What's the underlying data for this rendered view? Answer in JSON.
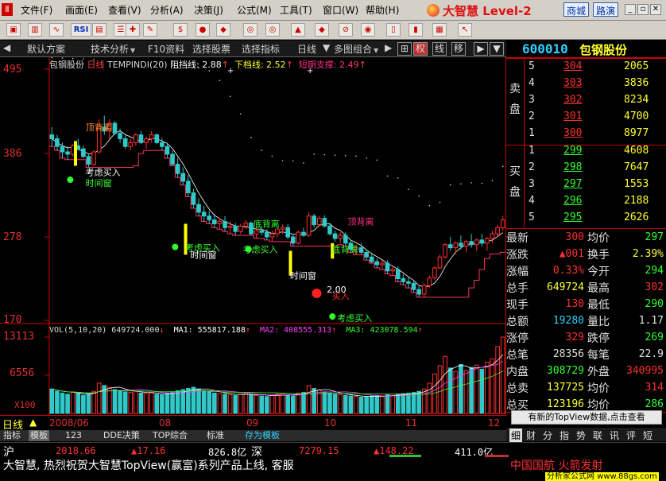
{
  "menu": {
    "items": [
      "文件(F)",
      "画面(E)",
      "查看(V)",
      "分析(A)",
      "决策(J)",
      "公式(M)",
      "工具(T)",
      "窗口(W)",
      "帮助(H)"
    ],
    "brand": "大智慧 Level-2",
    "mall": "商城",
    "roadshow": "路演"
  },
  "toolbar": {
    "icons": [
      "open-icon",
      "kline-icon",
      "minute-icon",
      "rsi-icon",
      "stats-icon",
      "list-icon",
      "crosshair-icon",
      "draw-icon",
      "dollar-icon",
      "traffic-icon",
      "diamond-icon",
      "binoculars-icon",
      "binoculars2-icon",
      "flag-icon",
      "warning-icon",
      "ban-icon",
      "globe-icon",
      "notepad-icon",
      "books-icon",
      "grid-icon",
      "help-arrow-icon"
    ]
  },
  "tabs": {
    "items": [
      "默认方案",
      "技术分析",
      "F10资料",
      "选择股票",
      "选择指标",
      "日线",
      "多图组合"
    ],
    "right": [
      "权",
      "线",
      "移",
      "▶"
    ]
  },
  "chart": {
    "title": "包钢股份",
    "period": "日线",
    "indicator": "TEMPINDI(20)",
    "resistance_label": "阻挡线: 2.88",
    "support_label": "下档线: 2.52",
    "short_support_label": "短期支撑: 2.49",
    "y_ticks": [
      "495",
      "386",
      "278",
      "170"
    ],
    "vol_header": "VOL(5,10,20) 649724.000",
    "ma1": "MA1: 555817.188",
    "ma2": "MA2: 408555.313",
    "ma3": "MA3: 423078.594",
    "vol_ticks": [
      "13113",
      "6556",
      "X100"
    ],
    "date_ticks": [
      "2008/06",
      "08",
      "09",
      "10",
      "11",
      "12"
    ],
    "period_badge": "日线",
    "annotations": [
      "顶背离",
      "考虑买入",
      "时间窗",
      "考虑买入",
      "时间窗",
      "底背离",
      "考虑买入",
      "时间窗",
      "买入",
      "2.00",
      "顶背离",
      "底背离",
      "考虑买入"
    ],
    "colors": {
      "up": "#ff3030",
      "down": "#30c8c8",
      "ma": "#ffffff",
      "signal": "#ffff00",
      "support": "#ff3060"
    },
    "vol_ymax": 13113,
    "chart_data": {
      "type": "candlestick",
      "price_axis": [
        1.7,
        4.95
      ],
      "ohlc": [
        [
          4.1,
          4.2,
          3.95,
          4.05
        ],
        [
          4.05,
          4.1,
          3.9,
          3.95
        ],
        [
          3.95,
          4.0,
          3.8,
          3.88
        ],
        [
          3.88,
          3.95,
          3.78,
          3.85
        ],
        [
          3.85,
          3.98,
          3.82,
          3.96
        ],
        [
          3.96,
          4.05,
          3.9,
          3.92
        ],
        [
          3.92,
          3.96,
          3.8,
          3.82
        ],
        [
          3.82,
          3.86,
          3.68,
          3.72
        ],
        [
          3.72,
          3.9,
          3.7,
          3.88
        ],
        [
          3.88,
          4.3,
          3.86,
          4.2
        ],
        [
          4.2,
          4.35,
          4.1,
          4.15
        ],
        [
          4.15,
          4.3,
          4.05,
          4.25
        ],
        [
          4.25,
          4.28,
          4.1,
          4.12
        ],
        [
          4.12,
          4.18,
          4.0,
          4.05
        ],
        [
          4.05,
          4.1,
          3.92,
          3.95
        ],
        [
          3.95,
          4.05,
          3.9,
          4.0
        ],
        [
          4.0,
          4.12,
          3.96,
          4.1
        ],
        [
          4.1,
          4.15,
          3.98,
          4.0
        ],
        [
          4.0,
          4.08,
          3.92,
          4.05
        ],
        [
          4.05,
          4.15,
          4.0,
          4.1
        ],
        [
          4.1,
          4.12,
          3.98,
          4.0
        ],
        [
          4.0,
          4.06,
          3.9,
          3.95
        ],
        [
          3.95,
          4.0,
          3.8,
          3.85
        ],
        [
          3.85,
          3.9,
          3.7,
          3.72
        ],
        [
          3.72,
          3.8,
          3.55,
          3.6
        ],
        [
          3.6,
          3.68,
          3.45,
          3.5
        ],
        [
          3.5,
          3.58,
          3.3,
          3.35
        ],
        [
          3.35,
          3.4,
          3.15,
          3.2
        ],
        [
          3.2,
          3.28,
          3.05,
          3.1
        ],
        [
          3.1,
          3.18,
          2.98,
          3.05
        ],
        [
          3.05,
          3.12,
          2.95,
          3.0
        ],
        [
          3.0,
          3.08,
          2.9,
          2.95
        ],
        [
          2.95,
          3.02,
          2.88,
          2.98
        ],
        [
          2.98,
          3.05,
          2.85,
          2.9
        ],
        [
          2.9,
          2.98,
          2.82,
          2.92
        ],
        [
          2.92,
          2.96,
          2.8,
          2.85
        ],
        [
          2.85,
          2.95,
          2.82,
          2.92
        ],
        [
          2.92,
          3.0,
          2.88,
          2.96
        ],
        [
          2.96,
          2.98,
          2.8,
          2.82
        ],
        [
          2.82,
          2.9,
          2.76,
          2.86
        ],
        [
          2.86,
          2.92,
          2.8,
          2.84
        ],
        [
          2.84,
          2.88,
          2.74,
          2.78
        ],
        [
          2.78,
          2.86,
          2.72,
          2.82
        ],
        [
          2.82,
          2.9,
          2.78,
          2.88
        ],
        [
          2.88,
          2.94,
          2.82,
          2.9
        ],
        [
          2.9,
          2.95,
          2.75,
          2.78
        ],
        [
          2.78,
          2.82,
          2.66,
          2.7
        ],
        [
          2.7,
          2.86,
          2.68,
          2.84
        ],
        [
          2.84,
          2.9,
          2.78,
          2.8
        ],
        [
          2.8,
          3.1,
          2.78,
          3.05
        ],
        [
          3.05,
          3.08,
          2.9,
          2.94
        ],
        [
          2.94,
          3.05,
          2.92,
          3.02
        ],
        [
          3.02,
          3.06,
          2.9,
          2.92
        ],
        [
          2.92,
          2.96,
          2.8,
          2.82
        ],
        [
          2.82,
          2.86,
          2.72,
          2.76
        ],
        [
          2.76,
          2.84,
          2.7,
          2.8
        ],
        [
          2.8,
          2.84,
          2.66,
          2.7
        ],
        [
          2.7,
          2.74,
          2.58,
          2.62
        ],
        [
          2.62,
          2.68,
          2.55,
          2.64
        ],
        [
          2.64,
          2.7,
          2.56,
          2.58
        ],
        [
          2.58,
          2.62,
          2.48,
          2.52
        ],
        [
          2.52,
          2.56,
          2.44,
          2.46
        ],
        [
          2.46,
          2.5,
          2.38,
          2.42
        ],
        [
          2.42,
          2.48,
          2.36,
          2.44
        ],
        [
          2.44,
          2.48,
          2.3,
          2.34
        ],
        [
          2.34,
          2.4,
          2.28,
          2.36
        ],
        [
          2.36,
          2.4,
          2.2,
          2.24
        ],
        [
          2.24,
          2.3,
          2.16,
          2.2
        ],
        [
          2.2,
          2.26,
          2.12,
          2.18
        ],
        [
          2.18,
          2.22,
          2.06,
          2.1
        ],
        [
          2.1,
          2.14,
          2.0,
          2.04
        ],
        [
          2.04,
          2.18,
          2.0,
          2.15
        ],
        [
          2.15,
          2.28,
          2.12,
          2.25
        ],
        [
          2.25,
          2.4,
          2.22,
          2.38
        ],
        [
          2.38,
          2.55,
          2.36,
          2.52
        ],
        [
          2.52,
          2.7,
          2.5,
          2.68
        ],
        [
          2.68,
          2.78,
          2.6,
          2.64
        ],
        [
          2.64,
          2.72,
          2.56,
          2.7
        ],
        [
          2.7,
          2.8,
          2.62,
          2.66
        ],
        [
          2.66,
          2.74,
          2.58,
          2.72
        ],
        [
          2.72,
          2.82,
          2.64,
          2.68
        ],
        [
          2.68,
          2.76,
          2.6,
          2.74
        ],
        [
          2.74,
          2.82,
          2.66,
          2.7
        ],
        [
          2.7,
          2.78,
          2.6,
          2.76
        ],
        [
          2.76,
          2.86,
          2.7,
          2.82
        ],
        [
          2.82,
          2.94,
          2.78,
          2.9
        ],
        [
          2.9,
          3.05,
          2.86,
          3.0
        ]
      ],
      "volume": [
        4200,
        3800,
        3500,
        3300,
        3600,
        3400,
        3100,
        3300,
        3800,
        5200,
        4800,
        4500,
        4100,
        3900,
        3700,
        3600,
        3800,
        3500,
        3400,
        3600,
        3300,
        3200,
        3400,
        3600,
        3900,
        4100,
        4300,
        4500,
        4200,
        3900,
        3700,
        3500,
        3400,
        3300,
        3200,
        3100,
        3300,
        3500,
        3200,
        3100,
        3000,
        2900,
        3100,
        3300,
        3400,
        3200,
        3000,
        3500,
        3600,
        4800,
        4300,
        4000,
        3700,
        3500,
        3300,
        3200,
        3100,
        3000,
        2900,
        2800,
        2900,
        3000,
        3100,
        2900,
        3200,
        3100,
        3300,
        3400,
        3500,
        3600,
        3800,
        4200,
        5200,
        6800,
        8200,
        9800,
        7800,
        7200,
        8400,
        7400,
        7900,
        8300,
        7600,
        8800,
        9400,
        11500,
        13113
      ]
    }
  },
  "quote": {
    "code": "600010",
    "name": "包钢股份",
    "sell_label": "卖盘",
    "buy_label": "买盘",
    "sells": [
      {
        "n": "5",
        "p": "304",
        "v": "2065"
      },
      {
        "n": "4",
        "p": "303",
        "v": "3836"
      },
      {
        "n": "3",
        "p": "302",
        "v": "8234"
      },
      {
        "n": "2",
        "p": "301",
        "v": "4700"
      },
      {
        "n": "1",
        "p": "300",
        "v": "8977"
      }
    ],
    "buys": [
      {
        "n": "1",
        "p": "299",
        "v": "4608"
      },
      {
        "n": "2",
        "p": "298",
        "v": "7647"
      },
      {
        "n": "3",
        "p": "297",
        "v": "1553"
      },
      {
        "n": "4",
        "p": "296",
        "v": "2188"
      },
      {
        "n": "5",
        "p": "295",
        "v": "2626"
      }
    ],
    "stats": [
      {
        "l": "最新",
        "v": "300",
        "l2": "均价",
        "v2": "297",
        "c1": "#ff3030",
        "c2": "#30ff30"
      },
      {
        "l": "涨跌",
        "v": "▲001",
        "l2": "换手",
        "v2": "2.39%",
        "c1": "#ff3030",
        "c2": "#ffff30"
      },
      {
        "l": "涨幅",
        "v": "0.33%",
        "l2": "今开",
        "v2": "294",
        "c1": "#ff3030",
        "c2": "#30ff30"
      },
      {
        "l": "总手",
        "v": "649724",
        "l2": "最高",
        "v2": "302",
        "c1": "#ffff30",
        "c2": "#ff3030"
      },
      {
        "l": "现手",
        "v": "130",
        "l2": "最低",
        "v2": "290",
        "c1": "#ff3030",
        "c2": "#30ff30"
      },
      {
        "l": "总额",
        "v": "19280",
        "l2": "量比",
        "v2": "1.17",
        "c1": "#30d0ff",
        "c2": "#e0e0e0"
      },
      {
        "l": "涨停",
        "v": "329",
        "l2": "跌停",
        "v2": "269",
        "c1": "#ff3030",
        "c2": "#30ff30"
      },
      {
        "l": "总笔",
        "v": "28356",
        "l2": "每笔",
        "v2": "22.9",
        "c1": "#e0e0e0",
        "c2": "#e0e0e0"
      },
      {
        "l": "内盘",
        "v": "308729",
        "l2": "外盘",
        "v2": "340995",
        "c1": "#30ff30",
        "c2": "#ff3030"
      },
      {
        "l": "总卖",
        "v": "137725",
        "l2": "均价",
        "v2": "314",
        "c1": "#ffff30",
        "c2": "#ff3030"
      },
      {
        "l": "总买",
        "v": "123196",
        "l2": "均价",
        "v2": "286",
        "c1": "#ffff30",
        "c2": "#30ff30"
      }
    ],
    "topview_button": "有新的TopView数据,点击查看",
    "bottom_tabs": [
      "细",
      "财",
      "分",
      "指",
      "势",
      "联",
      "讯",
      "评",
      "短"
    ]
  },
  "bottom_tabs": [
    "指标",
    "模板",
    "123",
    "DDE决策",
    "TOP综合",
    "标准",
    "存为模板"
  ],
  "status": {
    "sh_label": "沪",
    "sh_index": "2018.66",
    "sh_change": "▲17.16",
    "sh_amount": "826.8亿",
    "sz_label": "深",
    "sz_index": "7279.15",
    "sz_change": "▲148.22",
    "sz_amount": "411.0亿",
    "news": "大智慧, 热烈祝贺大智慧TopView(赢富)系列产品上线, 客服",
    "news2": "中国国航 火箭发射",
    "site": "分析家公式网 www.88gs.com"
  }
}
